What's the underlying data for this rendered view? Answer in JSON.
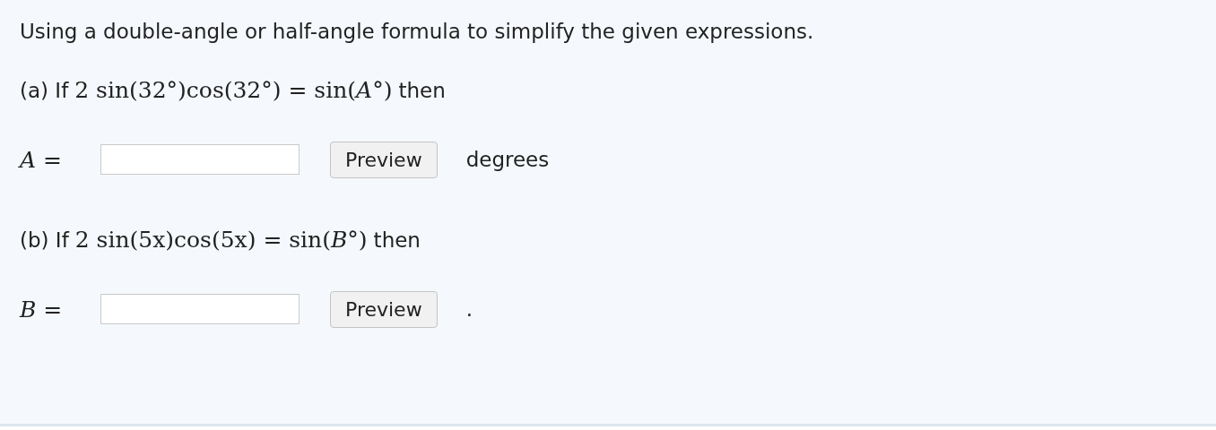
{
  "instructions": "Using a double-angle or half-angle formula to simplify the given expressions.",
  "parts": [
    {
      "label": "(a) If",
      "expression": "2 sin(32°)cos(32°) = sin(*A*°)",
      "suffix": "then",
      "answer_label": "*A* =",
      "button": "Preview",
      "unit": "degrees"
    },
    {
      "label": "(b) If",
      "expression": "2 sin(5x)cos(5x) = sin(*B*°)",
      "suffix": "then",
      "answer_label": "*B* =",
      "button": "Preview",
      "unit": "."
    }
  ]
}
